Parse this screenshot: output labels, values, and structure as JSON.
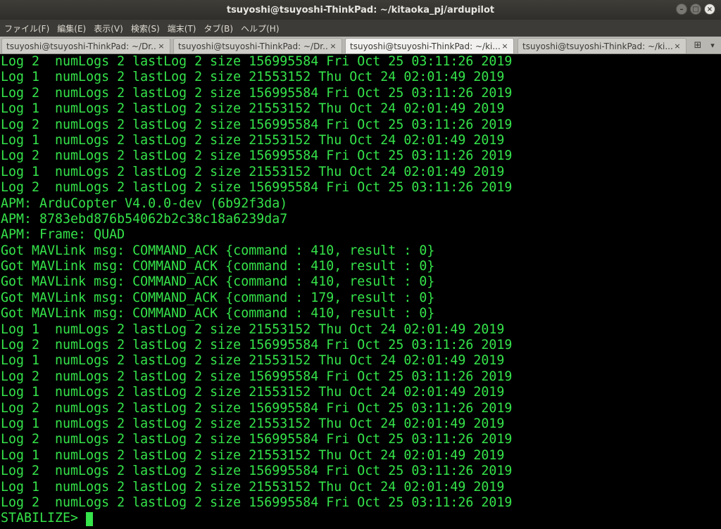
{
  "window": {
    "title": "tsuyoshi@tsuyoshi-ThinkPad: ~/kitaoka_pj/ardupilot",
    "minimize_glyph": "–",
    "maximize_glyph": "□",
    "close_glyph": "×"
  },
  "menu": {
    "items": [
      "ファイル(F)",
      "編集(E)",
      "表示(V)",
      "検索(S)",
      "端末(T)",
      "タブ(B)",
      "ヘルプ(H)"
    ]
  },
  "tabs": [
    {
      "label": "tsuyoshi@tsuyoshi-ThinkPad: ~/Dr...",
      "active": false
    },
    {
      "label": "tsuyoshi@tsuyoshi-ThinkPad: ~/Dr...",
      "active": false
    },
    {
      "label": "tsuyoshi@tsuyoshi-ThinkPad: ~/ki...",
      "active": true
    },
    {
      "label": "tsuyoshi@tsuyoshi-ThinkPad: ~/ki...",
      "active": false
    }
  ],
  "tab_close_glyph": "×",
  "tab_new_glyph": "⊞",
  "tab_menu_glyph": "▾",
  "terminal": {
    "lines": [
      "Log 2  numLogs 2 lastLog 2 size 156995584 Fri Oct 25 03:11:26 2019",
      "Log 1  numLogs 2 lastLog 2 size 21553152 Thu Oct 24 02:01:49 2019",
      "Log 2  numLogs 2 lastLog 2 size 156995584 Fri Oct 25 03:11:26 2019",
      "Log 1  numLogs 2 lastLog 2 size 21553152 Thu Oct 24 02:01:49 2019",
      "Log 2  numLogs 2 lastLog 2 size 156995584 Fri Oct 25 03:11:26 2019",
      "Log 1  numLogs 2 lastLog 2 size 21553152 Thu Oct 24 02:01:49 2019",
      "Log 2  numLogs 2 lastLog 2 size 156995584 Fri Oct 25 03:11:26 2019",
      "Log 1  numLogs 2 lastLog 2 size 21553152 Thu Oct 24 02:01:49 2019",
      "Log 2  numLogs 2 lastLog 2 size 156995584 Fri Oct 25 03:11:26 2019",
      "APM: ArduCopter V4.0.0-dev (6b92f3da)",
      "APM: 8783ebd876b54062b2c38c18a6239da7",
      "APM: Frame: QUAD",
      "Got MAVLink msg: COMMAND_ACK {command : 410, result : 0}",
      "Got MAVLink msg: COMMAND_ACK {command : 410, result : 0}",
      "Got MAVLink msg: COMMAND_ACK {command : 410, result : 0}",
      "Got MAVLink msg: COMMAND_ACK {command : 179, result : 0}",
      "Got MAVLink msg: COMMAND_ACK {command : 410, result : 0}",
      "Log 1  numLogs 2 lastLog 2 size 21553152 Thu Oct 24 02:01:49 2019",
      "Log 2  numLogs 2 lastLog 2 size 156995584 Fri Oct 25 03:11:26 2019",
      "Log 1  numLogs 2 lastLog 2 size 21553152 Thu Oct 24 02:01:49 2019",
      "Log 2  numLogs 2 lastLog 2 size 156995584 Fri Oct 25 03:11:26 2019",
      "Log 1  numLogs 2 lastLog 2 size 21553152 Thu Oct 24 02:01:49 2019",
      "Log 2  numLogs 2 lastLog 2 size 156995584 Fri Oct 25 03:11:26 2019",
      "Log 1  numLogs 2 lastLog 2 size 21553152 Thu Oct 24 02:01:49 2019",
      "Log 2  numLogs 2 lastLog 2 size 156995584 Fri Oct 25 03:11:26 2019",
      "Log 1  numLogs 2 lastLog 2 size 21553152 Thu Oct 24 02:01:49 2019",
      "Log 2  numLogs 2 lastLog 2 size 156995584 Fri Oct 25 03:11:26 2019",
      "Log 1  numLogs 2 lastLog 2 size 21553152 Thu Oct 24 02:01:49 2019",
      "Log 2  numLogs 2 lastLog 2 size 156995584 Fri Oct 25 03:11:26 2019"
    ],
    "prompt": "STABILIZE>",
    "text_color": "#35e34a",
    "background_color": "#000000"
  }
}
